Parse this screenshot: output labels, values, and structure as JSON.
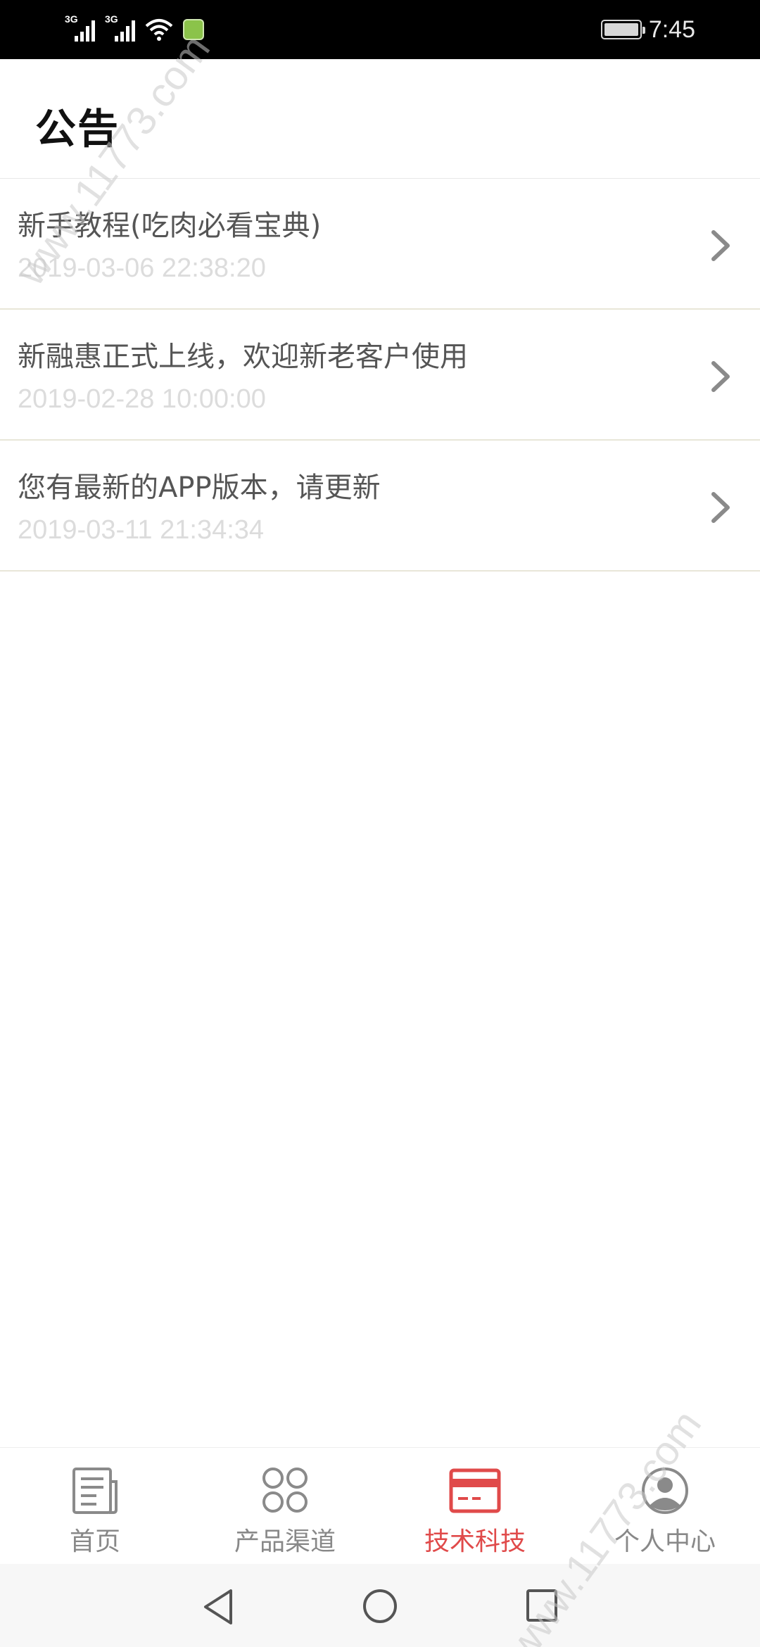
{
  "status_bar": {
    "signal_1_label": "3G",
    "signal_2_label": "3G",
    "time": "7:45"
  },
  "header": {
    "title": "公告"
  },
  "notices": [
    {
      "title": "新手教程(吃肉必看宝典)",
      "date": "2019-03-06 22:38:20"
    },
    {
      "title": "新融惠正式上线，欢迎新老客户使用",
      "date": "2019-02-28 10:00:00"
    },
    {
      "title": "您有最新的APP版本，请更新",
      "date": "2019-03-11 21:34:34"
    }
  ],
  "tabs": [
    {
      "label": "首页",
      "icon": "newspaper-icon",
      "active": false
    },
    {
      "label": "产品渠道",
      "icon": "four-circles-icon",
      "active": false
    },
    {
      "label": "技术科技",
      "icon": "card-icon",
      "active": true
    },
    {
      "label": "个人中心",
      "icon": "user-avatar-icon",
      "active": false
    }
  ],
  "watermark": {
    "text_top": "www.11773.com",
    "text_bottom": "www.11773.com"
  },
  "colors": {
    "accent": "#e04a4a",
    "tab_inactive": "#888888",
    "date_text": "#dcdcdc",
    "title_text": "#555555",
    "status_bar_bg": "#000000"
  }
}
